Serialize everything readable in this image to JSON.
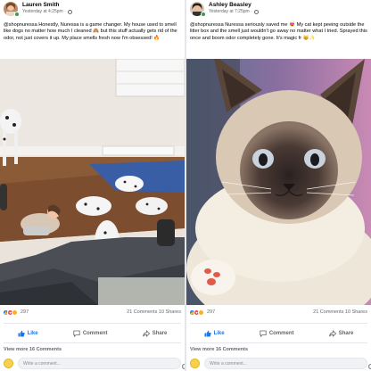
{
  "posts": [
    {
      "author": "Lauren Smith",
      "time": "Yesterday at 4:25pm ·",
      "caption": "@shopnuressa Honestly, Nuressa is a game changer. My house used to smell like dogs no matter how much I cleaned 🙈 but this stuff actually gets rid of the odor, not just covers it up. My place smells fresh now I'm obsessed! 🔥",
      "reaction_count": "297",
      "stats": "21 Comments 10 Shares",
      "like_label": "Like",
      "comment_label": "Comment",
      "share_label": "Share",
      "view_more": "View more 16 Comments",
      "comment_placeholder": "Write a comment..."
    },
    {
      "author": "Ashley Beasley",
      "time": "Yesterday at 7:25pm ·",
      "caption": "@shopnuressa Nuressa seriously saved me 😻 My cat kept peeing outside the litter box and the smell just wouldn't go away no matter what I tried. Sprayed this once and boom odor completely gone. It's magic fr 😸✨",
      "reaction_count": "297",
      "stats": "21 Comments 10 Shares",
      "like_label": "Like",
      "comment_label": "Comment",
      "share_label": "Share",
      "view_more": "View more 16 Comments",
      "comment_placeholder": "Write a comment..."
    }
  ],
  "colors": {
    "brand_blue": "#1877f2",
    "love_red": "#f33e58",
    "haha_yellow": "#f7b125",
    "muted_text": "#65676b"
  }
}
